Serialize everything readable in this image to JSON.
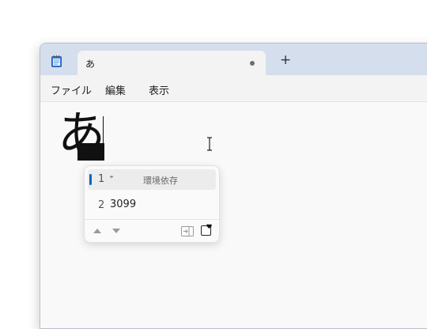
{
  "window": {
    "tab_title": "あ",
    "new_tab_symbol": "+"
  },
  "menu": {
    "items": [
      "ファイル",
      "編集",
      "表示"
    ]
  },
  "editor": {
    "text": "あ"
  },
  "ime": {
    "candidates": [
      {
        "number": "1",
        "text": "゛",
        "note": "環境依存",
        "selected": true
      },
      {
        "number": "2",
        "text": "3099",
        "note": "",
        "selected": false
      }
    ]
  },
  "colors": {
    "titlebar": "#d4deec",
    "accent": "#0067c0"
  },
  "icons": [
    "notepad-icon",
    "unsaved-dot-icon",
    "plus-icon",
    "ibeam-cursor-icon",
    "arrow-up-icon",
    "arrow-down-icon",
    "expand-panel-icon",
    "favorites-icon"
  ]
}
